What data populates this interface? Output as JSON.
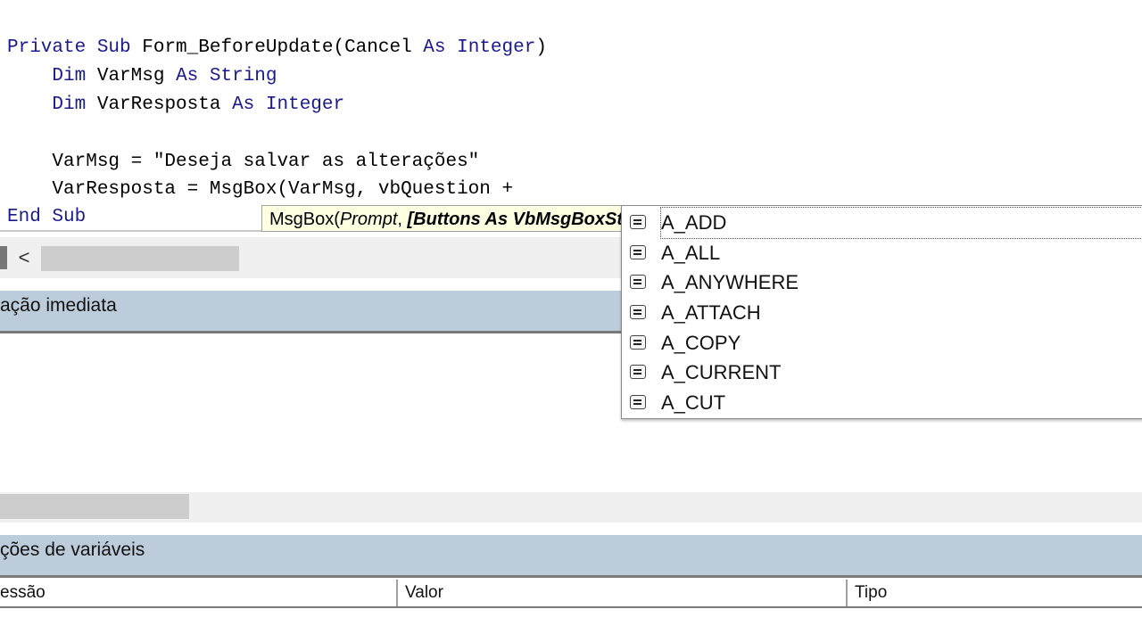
{
  "code": {
    "line1": {
      "kw1": "Private",
      "sp1": " ",
      "kw2": "Sub",
      "text": " Form_BeforeUpdate(Cancel ",
      "kw3": "As",
      "sp2": " ",
      "kw4": "Integer",
      "end": ")"
    },
    "line2": {
      "indent": "    ",
      "kw1": "Dim",
      "text": " VarMsg ",
      "kw2": "As",
      "sp": " ",
      "kw3": "String"
    },
    "line3": {
      "indent": "    ",
      "kw1": "Dim",
      "text": " VarResposta ",
      "kw2": "As",
      "sp": " ",
      "kw3": "Integer"
    },
    "line5": "    VarMsg = \"Deseja salvar as alterações\"",
    "line6": "    VarResposta = MsgBox(VarMsg, vbQuestion +",
    "line7": {
      "kw1": "End",
      "sp": " ",
      "kw2": "Sub"
    }
  },
  "tooltip": {
    "prefix": "MsgBox(",
    "prompt": "Prompt",
    "sep": ", ",
    "buttons": "[Buttons As VbMsgBoxStyle"
  },
  "immediate_window": {
    "title": "ação imediata"
  },
  "locals_window": {
    "title": "ções de variáveis",
    "columns": [
      "essão",
      "Valor",
      "Tipo"
    ]
  },
  "scroll": {
    "left_arrow": "<"
  },
  "autocomplete": {
    "items": [
      "A_ADD",
      "A_ALL",
      "A_ANYWHERE",
      "A_ATTACH",
      "A_COPY",
      "A_CURRENT",
      "A_CUT"
    ],
    "selected": "A_ADD",
    "icon": "constant-icon"
  }
}
